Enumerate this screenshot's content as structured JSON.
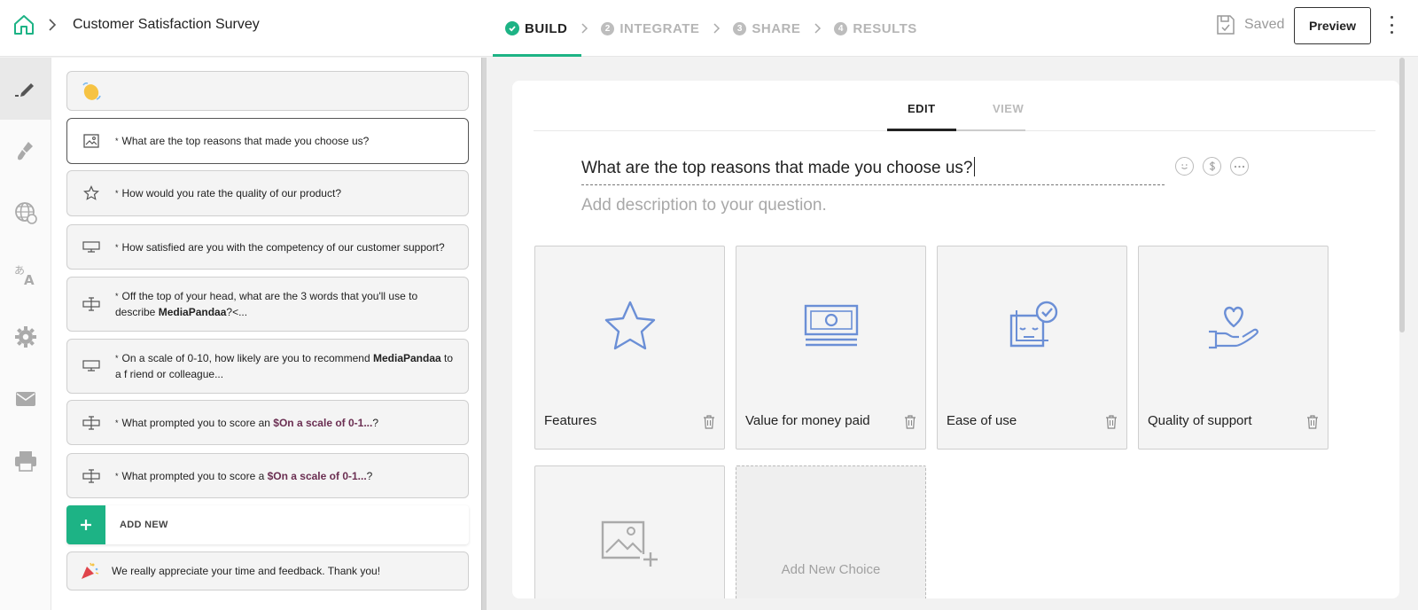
{
  "header": {
    "survey_title": "Customer Satisfaction Survey",
    "steps": [
      {
        "num": "",
        "label": "BUILD",
        "state": "active"
      },
      {
        "num": "2",
        "label": "INTEGRATE",
        "state": "inactive"
      },
      {
        "num": "3",
        "label": "SHARE",
        "state": "inactive"
      },
      {
        "num": "4",
        "label": "RESULTS",
        "state": "inactive"
      }
    ],
    "saved_label": "Saved",
    "preview_label": "Preview"
  },
  "rail": {
    "items": [
      "edit-pen-icon",
      "paint-brush-icon",
      "globe-icon",
      "translate-icon",
      "gear-icon",
      "mail-icon",
      "printer-icon"
    ]
  },
  "questions": {
    "welcome_icon": "waving-hand-icon",
    "items": [
      {
        "required": "*",
        "icon": "image-icon",
        "text": "What are the top reasons that made you choose us?"
      },
      {
        "required": "*",
        "icon": "star-icon",
        "text": "How would you rate the quality of our product?"
      },
      {
        "required": "*",
        "icon": "scale-icon",
        "text": "How satisfied are you with the competency of our customer support?"
      },
      {
        "required": "*",
        "icon": "text-input-icon",
        "text_a": "Off the top of your head, what are the 3 words that you'll use to describe ",
        "bold": "MediaPandaa",
        "text_b": "?<..."
      },
      {
        "required": "*",
        "icon": "scale-icon",
        "text_a": "On a scale of 0-10, how likely are you to recommend ",
        "bold": "MediaPandaa",
        "text_b": " to a f riend or colleague..."
      },
      {
        "required": "*",
        "icon": "text-input-icon",
        "text_a": "What prompted you to score an ",
        "pipe": "$On a scale of 0-1...",
        "text_b": "?"
      },
      {
        "required": "*",
        "icon": "text-input-icon",
        "text_a": "What prompted you to score a ",
        "pipe": "$On a scale of 0-1...",
        "text_b": "?"
      }
    ],
    "add_new_label": "ADD NEW",
    "thank_you": {
      "icon": "party-popper-icon",
      "text": "We really appreciate your time and feedback. Thank you!"
    }
  },
  "editor": {
    "tabs": {
      "edit": "EDIT",
      "view": "VIEW"
    },
    "question_title": "What are the top reasons that made you choose us?",
    "description_placeholder": "Add description to your question.",
    "choices": [
      {
        "label": "Features",
        "icon": "star-outline-icon"
      },
      {
        "label": "Value for money paid",
        "icon": "banknote-icon"
      },
      {
        "label": "Ease of use",
        "icon": "ease-of-use-icon"
      },
      {
        "label": "Quality of support",
        "icon": "heart-hand-icon"
      },
      {
        "label": "",
        "icon": "add-image-icon"
      }
    ],
    "add_choice_label": "Add New Choice"
  },
  "colors": {
    "accent": "#1db385",
    "icon_blue": "#6b8fd6",
    "pipe": "#6b2f52"
  }
}
